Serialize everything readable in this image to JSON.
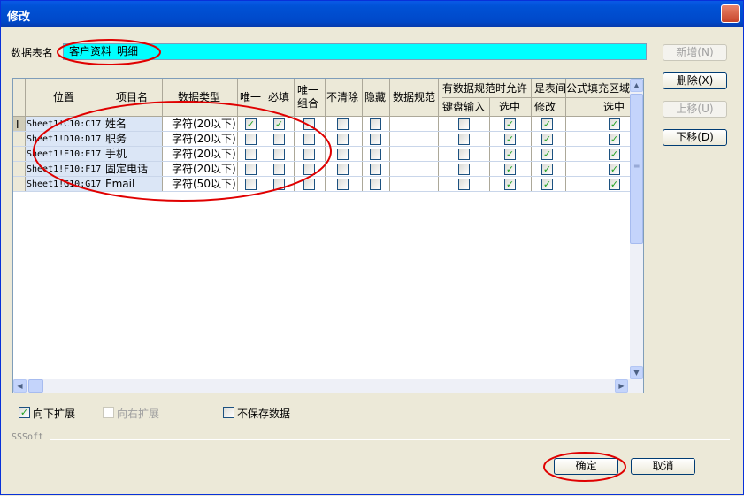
{
  "window": {
    "title": "修改",
    "close_glyph": "✕"
  },
  "tablename": {
    "label": "数据表名",
    "value": "客户资料_明细"
  },
  "side_buttons": {
    "add": "新增(N)",
    "delete": "删除(X)",
    "up": "上移(U)",
    "down": "下移(D)"
  },
  "grid": {
    "header_top": {
      "position": "位置",
      "item": "项目名",
      "datatype": "数据类型",
      "unique": "唯一",
      "required": "必填",
      "unique_combo_1": "唯一",
      "unique_combo_2": "组合",
      "noclear": "不清除",
      "hidden": "隐藏",
      "spec": "数据规范",
      "allow_group": "有数据规范时允许",
      "is_table": "是表间",
      "formula": "公式填充区域"
    },
    "header_sub": {
      "keyboard": "键盘输入",
      "select": "选中",
      "modify": "修改",
      "formula_select": "选中"
    },
    "row_cursor": "I",
    "rows": [
      {
        "position": "Sheet1!C10:C17",
        "item": "姓名",
        "type": "字符(20以下)",
        "checks": [
          true,
          true,
          false,
          false,
          false,
          false,
          true,
          true,
          true
        ]
      },
      {
        "position": "Sheet1!D10:D17",
        "item": "职务",
        "type": "字符(20以下)",
        "checks": [
          false,
          false,
          false,
          false,
          false,
          false,
          true,
          true,
          true
        ]
      },
      {
        "position": "Sheet1!E10:E17",
        "item": "手机",
        "type": "字符(20以下)",
        "checks": [
          false,
          false,
          false,
          false,
          false,
          false,
          true,
          true,
          true
        ]
      },
      {
        "position": "Sheet1!F10:F17",
        "item": "固定电话",
        "type": "字符(20以下)",
        "checks": [
          false,
          false,
          false,
          false,
          false,
          false,
          true,
          true,
          true
        ]
      },
      {
        "position": "Sheet1!G10:G17",
        "item": "Email",
        "type": "字符(50以下)",
        "checks": [
          false,
          false,
          false,
          false,
          false,
          false,
          true,
          true,
          true
        ]
      }
    ]
  },
  "options": {
    "expand_down": {
      "label": "向下扩展",
      "checked": true
    },
    "expand_right": {
      "label": "向右扩展",
      "checked": false
    },
    "no_save": {
      "label": "不保存数据",
      "checked": false
    }
  },
  "brand": "SSSoft",
  "footer": {
    "ok": "确定",
    "cancel": "取消"
  },
  "icons": {
    "check_glyph": "✓",
    "scroll_up": "▲",
    "scroll_down": "▼",
    "scroll_left": "◀",
    "scroll_right": "▶",
    "grip": "≡"
  },
  "colors": {
    "title_bar": "#0052d6",
    "name_field": "#00ffff",
    "check": "#21a121",
    "annotation": "#e00000"
  }
}
